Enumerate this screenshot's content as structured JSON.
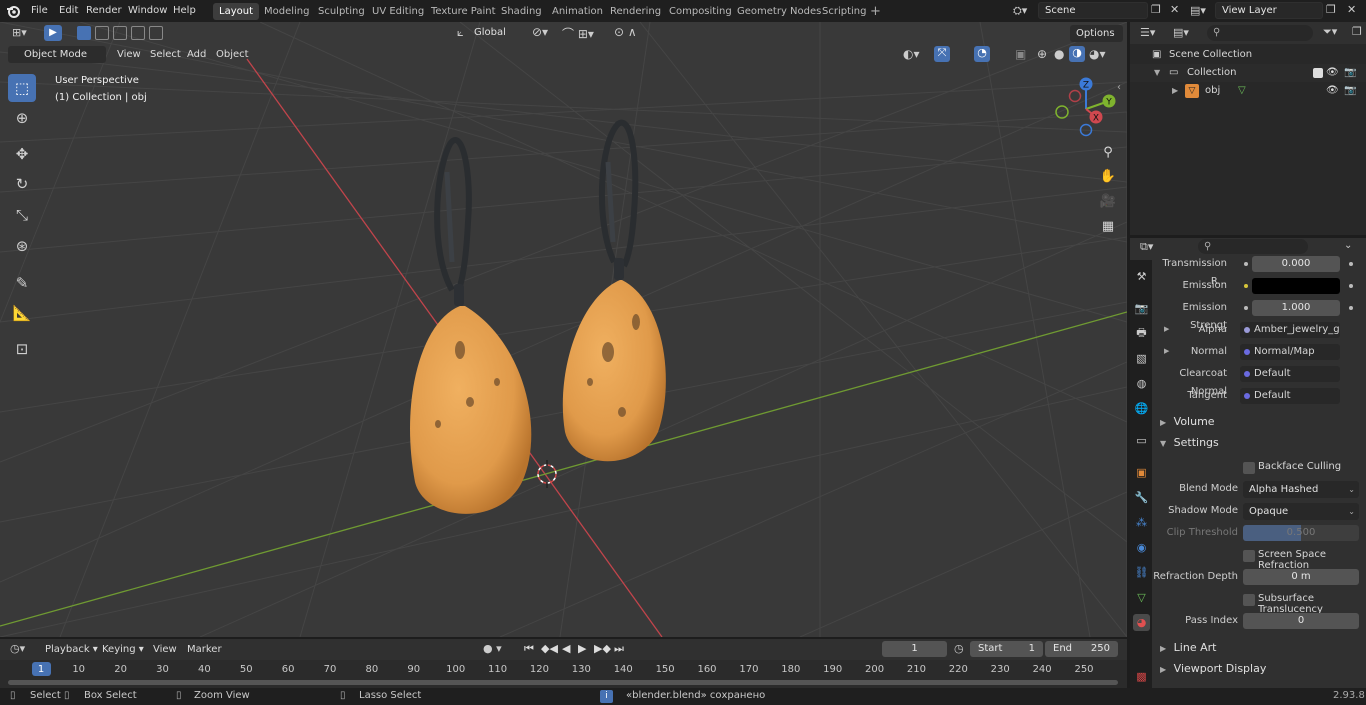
{
  "menu": [
    "File",
    "Edit",
    "Render",
    "Window",
    "Help"
  ],
  "workspaces": [
    "Layout",
    "Modeling",
    "Sculpting",
    "UV Editing",
    "Texture Paint",
    "Shading",
    "Animation",
    "Rendering",
    "Compositing",
    "Geometry Nodes",
    "Scripting"
  ],
  "active_workspace": "Layout",
  "scene_name": "Scene",
  "view_layer_name": "View Layer",
  "viewport": {
    "mode": "Object Mode",
    "menus": [
      "View",
      "Select",
      "Add",
      "Object"
    ],
    "transform_orientation": "Global",
    "options_label": "Options",
    "perspective_label": "User Perspective",
    "collection_label": "(1) Collection | obj",
    "gizmo_axes": [
      "X",
      "Y",
      "Z"
    ]
  },
  "outliner": {
    "scene_collection": "Scene Collection",
    "collection": "Collection",
    "object": "obj"
  },
  "properties": {
    "rows": [
      {
        "label": "Transmission R...",
        "value": "0.000"
      },
      {
        "label": "Emission",
        "value": ""
      },
      {
        "label": "Emission Strengt",
        "value": "1.000"
      },
      {
        "label": "Alpha",
        "value": "Amber_jewelry_geo..."
      },
      {
        "label": "Normal",
        "value": "Normal/Map"
      },
      {
        "label": "Clearcoat Normal",
        "value": "Default"
      },
      {
        "label": "Tangent",
        "value": "Default"
      }
    ],
    "volume_label": "Volume",
    "settings_label": "Settings",
    "backface_culling": "Backface Culling",
    "blend_mode_label": "Blend Mode",
    "blend_mode": "Alpha Hashed",
    "shadow_mode_label": "Shadow Mode",
    "shadow_mode": "Opaque",
    "clip_threshold_label": "Clip Threshold",
    "clip_threshold": "0.500",
    "screen_space_refraction": "Screen Space Refraction",
    "refraction_depth_label": "Refraction Depth",
    "refraction_depth": "0 m",
    "subsurface_translucency": "Subsurface Translucency",
    "pass_index_label": "Pass Index",
    "pass_index": "0",
    "line_art_label": "Line Art",
    "viewport_display_label": "Viewport Display"
  },
  "timeline": {
    "playback_label": "Playback",
    "keying_label": "Keying",
    "view_label": "View",
    "marker_label": "Marker",
    "current_frame": "1",
    "start_label": "Start",
    "start_value": "1",
    "end_label": "End",
    "end_value": "250",
    "ticks": [
      "1",
      "10",
      "20",
      "30",
      "40",
      "50",
      "60",
      "70",
      "80",
      "90",
      "100",
      "110",
      "120",
      "130",
      "140",
      "150",
      "160",
      "170",
      "180",
      "190",
      "200",
      "210",
      "220",
      "230",
      "240",
      "250"
    ]
  },
  "status": {
    "select": "Select",
    "box_select": "Box Select",
    "zoom_view": "Zoom View",
    "lasso_select": "Lasso Select",
    "message": "«blender.blend» сохранено",
    "version": "2.93.8"
  },
  "colors": {
    "accent": "#4772b3",
    "amber": "#e09a4a",
    "x_axis": "#d0484f",
    "y_axis": "#7fb32e",
    "z_axis": "#3b7ad8"
  }
}
